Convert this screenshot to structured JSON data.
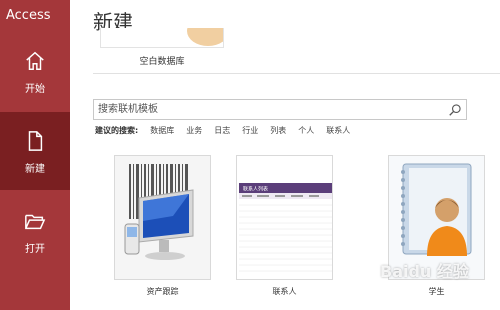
{
  "sidebar": {
    "app_title": "Access",
    "items": [
      {
        "label": "开始",
        "icon": "home-icon"
      },
      {
        "label": "新建",
        "icon": "new-document-icon"
      },
      {
        "label": "打开",
        "icon": "open-folder-icon"
      }
    ],
    "bg_color": "#a4373a",
    "selected_color": "#7a1f21"
  },
  "main": {
    "title": "新建",
    "blank_database": {
      "label": "空白数据库"
    },
    "search": {
      "placeholder": "搜索联机模板",
      "icon": "search-icon"
    },
    "suggested": {
      "label": "建议的搜索:",
      "items": [
        "数据库",
        "业务",
        "日志",
        "行业",
        "列表",
        "个人",
        "联系人"
      ]
    },
    "templates": [
      {
        "label": "资产跟踪",
        "icon": "barcode-monitor-icon"
      },
      {
        "label": "联系人",
        "icon": "contact-list-preview"
      },
      {
        "label": "学生",
        "icon": "student-notebook-icon"
      }
    ],
    "contact_preview_title": "联系人列表"
  },
  "watermark": "Baidu 经验"
}
